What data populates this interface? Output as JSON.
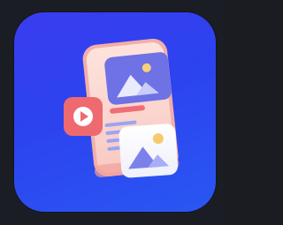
{
  "app_icon": {
    "name": "media-gallery-app-icon",
    "colors": {
      "background_top": "#3a3df0",
      "background_bottom": "#2a57f3",
      "phone_body": "#fbd5cf",
      "phone_frame": "#f2a7a2",
      "image_card": "#6f74e6",
      "play_button": "#ef6b6f",
      "text_lines": "#9aa6f3",
      "accent_red": "#ec5f6a",
      "sun": "#f5c96a"
    },
    "icons": [
      "phone-icon",
      "image-icon",
      "play-icon",
      "photo-card-icon",
      "text-lines-icon"
    ]
  }
}
